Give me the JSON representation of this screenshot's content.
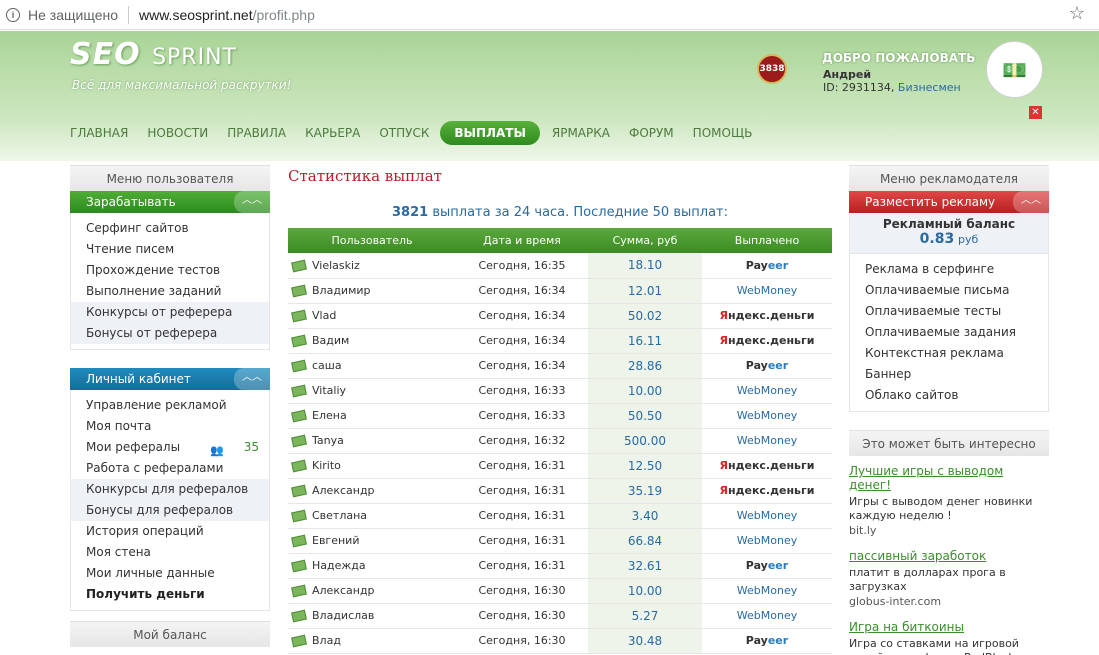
{
  "browser": {
    "security": "Не защищено",
    "host": "www.seosprint.net",
    "path": "/profit.php"
  },
  "header": {
    "logo_seo": "SEO",
    "logo_sprint": "SPRINT",
    "slogan": "Всё для максимальной раскрутки!",
    "rating": "3838",
    "welcome": "ДОБРО ПОЖАЛОВАТЬ",
    "user_name": "Андрей",
    "user_id": "ID: 2931134,",
    "status": "Бизнесмен"
  },
  "nav": [
    "ГЛАВНАЯ",
    "НОВОСТИ",
    "ПРАВИЛА",
    "КАРЬЕРА",
    "ОТПУСК",
    "ВЫПЛАТЫ",
    "ЯРМАРКА",
    "ФОРУМ",
    "ПОМОЩЬ"
  ],
  "left": {
    "user_menu_title": "Меню пользователя",
    "earn_title": "Зарабатывать",
    "earn_items": [
      "Серфинг сайтов",
      "Чтение писем",
      "Прохождение тестов",
      "Выполнение заданий",
      "Конкурсы от реферера",
      "Бонусы от реферера"
    ],
    "cabinet_title": "Личный кабинет",
    "cabinet_items": [
      "Управление рекламой",
      "Моя почта",
      "Мои рефералы",
      "Работа с рефералами",
      "Конкурсы для рефералов",
      "Бонусы для рефералов",
      "История операций",
      "Моя стена",
      "Мои личные данные",
      "Получить деньги"
    ],
    "referrals_count": "35",
    "balance_title": "Мой баланс"
  },
  "right": {
    "adv_menu_title": "Меню рекламодателя",
    "place_ad": "Разместить рекламу",
    "ad_balance_title": "Рекламный баланс",
    "ad_balance_value": "0.83",
    "ad_balance_unit": "руб",
    "adv_items": [
      "Реклама в серфинге",
      "Оплачиваемые письма",
      "Оплачиваемые тесты",
      "Оплачиваемые задания",
      "Контекстная реклама",
      "Баннер",
      "Облако сайтов"
    ],
    "interest_title": "Это может быть интересно",
    "ads": [
      {
        "title": "Лучшие игры с выводом денег!",
        "desc": "Игры с выводом денег новинки каждую неделю !",
        "link": "bit.ly"
      },
      {
        "title": "пассивный заработок",
        "desc": "платит в долларах прога в загрузках",
        "link": "globus-inter.com"
      },
      {
        "title": "Игра на биткоины",
        "desc": "Игра со ставками на игровой онлайн-платформе RedBlack",
        "link": ""
      }
    ]
  },
  "main": {
    "title": "Статистика выплат",
    "stat_count": "3821",
    "stat_text": "выплата за 24 часа. Последние 50 выплат:",
    "columns": [
      "Пользователь",
      "Дата и время",
      "Сумма, руб",
      "Выплачено"
    ],
    "rows": [
      {
        "user": "Vielaskiz",
        "date": "Сегодня, 16:35",
        "sum": "18.10",
        "pay": "payeer"
      },
      {
        "user": "Владимир",
        "date": "Сегодня, 16:34",
        "sum": "12.01",
        "pay": "wm"
      },
      {
        "user": "Vlad",
        "date": "Сегодня, 16:34",
        "sum": "50.02",
        "pay": "ym"
      },
      {
        "user": "Вадим",
        "date": "Сегодня, 16:34",
        "sum": "16.11",
        "pay": "ym"
      },
      {
        "user": "саша",
        "date": "Сегодня, 16:34",
        "sum": "28.86",
        "pay": "payeer"
      },
      {
        "user": "Vitaliy",
        "date": "Сегодня, 16:33",
        "sum": "10.00",
        "pay": "wm"
      },
      {
        "user": "Елена",
        "date": "Сегодня, 16:33",
        "sum": "50.50",
        "pay": "wm"
      },
      {
        "user": "Tanya",
        "date": "Сегодня, 16:32",
        "sum": "500.00",
        "pay": "wm"
      },
      {
        "user": "Kirito",
        "date": "Сегодня, 16:31",
        "sum": "12.50",
        "pay": "ym"
      },
      {
        "user": "Александр",
        "date": "Сегодня, 16:31",
        "sum": "35.19",
        "pay": "ym"
      },
      {
        "user": "Светлана",
        "date": "Сегодня, 16:31",
        "sum": "3.40",
        "pay": "wm"
      },
      {
        "user": "Евгений",
        "date": "Сегодня, 16:31",
        "sum": "66.84",
        "pay": "wm"
      },
      {
        "user": "Надежда",
        "date": "Сегодня, 16:31",
        "sum": "32.61",
        "pay": "payeer"
      },
      {
        "user": "Александр",
        "date": "Сегодня, 16:30",
        "sum": "10.00",
        "pay": "wm"
      },
      {
        "user": "Владислав",
        "date": "Сегодня, 16:30",
        "sum": "5.27",
        "pay": "wm"
      },
      {
        "user": "Влад",
        "date": "Сегодня, 16:30",
        "sum": "30.48",
        "pay": "payeer"
      }
    ],
    "pay_labels": {
      "payeer_a": "Pay",
      "payeer_b": "eer",
      "wm": "WebMoney",
      "ym_a": "Я",
      "ym_b": "ндекс.деньги"
    }
  }
}
